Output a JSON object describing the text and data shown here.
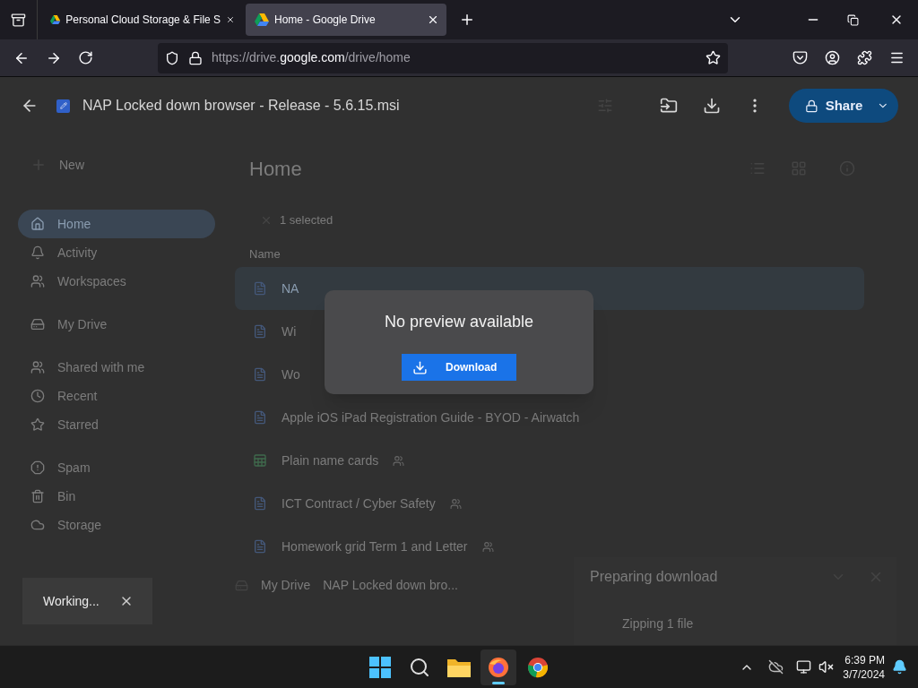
{
  "browser": {
    "tabs": [
      {
        "title": "Personal Cloud Storage & File S",
        "selected": false
      },
      {
        "title": "Home - Google Drive",
        "selected": true
      }
    ],
    "url": {
      "scheme": "https://drive.",
      "domain": "google.com",
      "path": "/drive/home"
    }
  },
  "viewer": {
    "title": "NAP Locked down browser - Release - 5.6.15.msi",
    "share_label": "Share"
  },
  "drive": {
    "new_label": "New",
    "nav_groups": [
      [
        {
          "label": "Home",
          "selected": true
        },
        {
          "label": "Activity",
          "selected": false
        },
        {
          "label": "Workspaces",
          "selected": false
        }
      ],
      [
        {
          "label": "My Drive",
          "selected": false
        }
      ],
      [
        {
          "label": "Shared with me",
          "selected": false
        },
        {
          "label": "Recent",
          "selected": false
        },
        {
          "label": "Starred",
          "selected": false
        }
      ],
      [
        {
          "label": "Spam",
          "selected": false
        },
        {
          "label": "Bin",
          "selected": false
        },
        {
          "label": "Storage",
          "selected": false
        }
      ]
    ],
    "heading": "Home",
    "selection": "1 selected",
    "column": "Name",
    "files": [
      {
        "name": "NA",
        "kind": "doc",
        "shared": false,
        "selected": true
      },
      {
        "name": "Wi",
        "kind": "doc",
        "shared": false,
        "selected": false
      },
      {
        "name": "Wo",
        "kind": "doc",
        "shared": false,
        "selected": false
      },
      {
        "name": "Apple iOS iPad Registration Guide - BYOD - Airwatch",
        "kind": "doc",
        "shared": false,
        "selected": false
      },
      {
        "name": "Plain name cards",
        "kind": "sheet",
        "shared": true,
        "selected": false
      },
      {
        "name": "ICT Contract / Cyber Safety",
        "kind": "doc",
        "shared": true,
        "selected": false
      },
      {
        "name": "Homework grid Term 1 and Letter",
        "kind": "doc",
        "shared": true,
        "selected": false
      }
    ],
    "breadcrumb": [
      "My Drive",
      "NAP Locked down bro..."
    ]
  },
  "download_panel": {
    "title": "Preparing download",
    "item": "Zipping 1 file"
  },
  "modal": {
    "message": "No preview available",
    "button": "Download"
  },
  "toast": {
    "message": "Working..."
  },
  "taskbar": {
    "apps": [
      {
        "kind": "start",
        "selected": false
      },
      {
        "kind": "search",
        "selected": false
      },
      {
        "kind": "files",
        "selected": false
      },
      {
        "kind": "firefox",
        "selected": true
      },
      {
        "kind": "chrome",
        "selected": false
      }
    ],
    "time": "6:39 PM",
    "date": "3/7/2024"
  }
}
